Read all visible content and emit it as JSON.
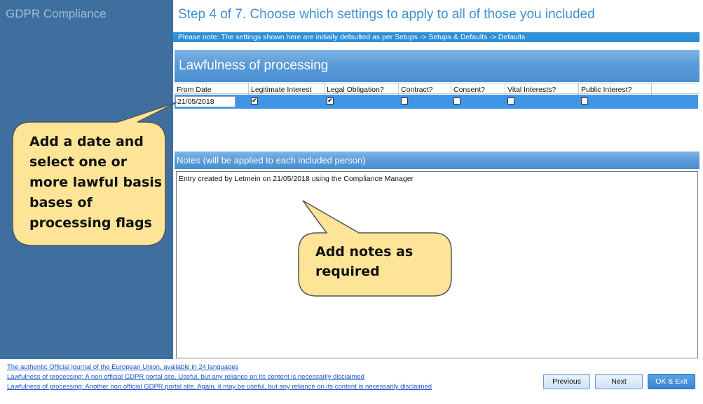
{
  "app": {
    "title": "GDPR Compliance"
  },
  "step": {
    "title": "Step 4 of 7. Choose which settings to apply to all of those you included"
  },
  "note": "Please note: The settings shown here are initially defaulted as per Setups -> Setups & Defaults -> Defaults",
  "section": {
    "title": "Lawfulness of processing"
  },
  "grid": {
    "columns": [
      "From Date",
      "Legitimate Interest",
      "Legal Obligation?",
      "Contract?",
      "Consent?",
      "Vital Interests?",
      "Public Interest?"
    ],
    "row": {
      "from_date": "21/05/2018",
      "legitimate_interest": true,
      "legal_obligation": true,
      "contract": false,
      "consent": false,
      "vital_interests": false,
      "public_interest": false
    }
  },
  "notes": {
    "header": "Notes (will be applied to each included person)",
    "text": "Entry created by Letmein on 21/05/2018 using the Compliance Manager"
  },
  "callouts": {
    "left": "Add a date and select one or more lawful basis bases of processing flags",
    "right": "Add notes as required"
  },
  "links": [
    "The authentic Official journal of the European Union, available in 24 languages",
    "Lawfulness of processing: A non official GDPR portal site. Useful, but any reliance on its content is necessarily disclaimed",
    "Lawfulness of processing: Another non official GDPR portal site. Again, it may be useful, but any reliance on its content is necessarily disclaimed"
  ],
  "buttons": {
    "previous": "Previous",
    "next": "Next",
    "ok_exit": "OK & Exit"
  },
  "colors": {
    "sidebar": "#3f6f9f",
    "accent": "#3f96e6",
    "callout_fill": "#fde497"
  }
}
